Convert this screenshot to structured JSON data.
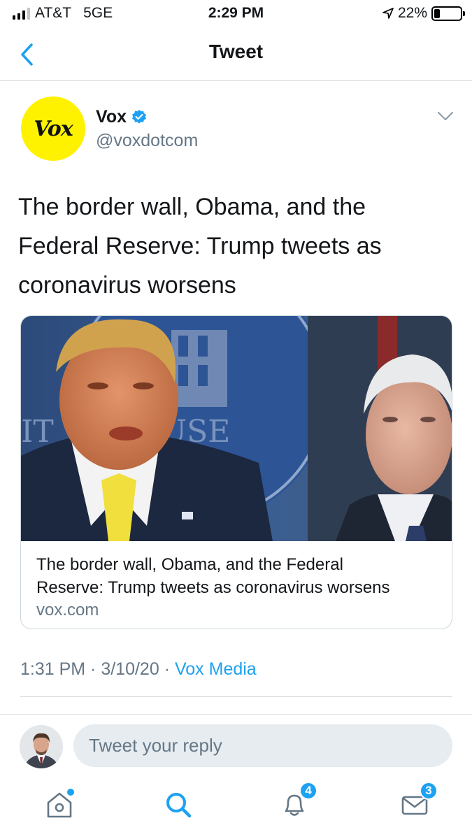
{
  "status_bar": {
    "carrier": "AT&T",
    "network": "5GE",
    "time": "2:29 PM",
    "battery": "22%",
    "battery_level": 0.22
  },
  "nav": {
    "title": "Tweet",
    "back_icon": "chevron-left-icon"
  },
  "tweet": {
    "avatar_text": "Vox",
    "author_name": "Vox",
    "handle": "@voxdotcom",
    "verified": true,
    "text": "The border wall, Obama, and the Federal Reserve: Trump tweets as coronavirus worsens",
    "card": {
      "title_line1": "The border wall, Obama, and the Federal",
      "title_line2": "Reserve: Trump tweets as coronavirus worsens",
      "domain": "vox.com"
    },
    "time": "1:31 PM",
    "separator": " · ",
    "date": "3/10/20",
    "source": "Vox Media"
  },
  "reply": {
    "placeholder": "Tweet your reply"
  },
  "tabbar": {
    "home_icon": "home-icon",
    "search_icon": "search-icon",
    "notifications_icon": "bell-icon",
    "notifications_count": "4",
    "messages_icon": "mail-icon",
    "messages_count": "3"
  },
  "colors": {
    "accent": "#1da1f2",
    "secondary_text": "#657786",
    "vox_yellow": "#fff200"
  }
}
